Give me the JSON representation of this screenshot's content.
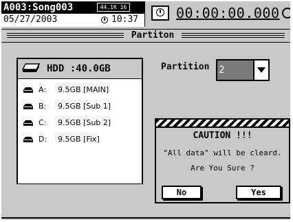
{
  "status": {
    "song": "A003:Song003",
    "fs_badge": "44.1K 16",
    "date": "05/27/2003",
    "time": "10:37",
    "counter": "00:00:00.000"
  },
  "title": "Partiton",
  "hdd": {
    "label": "HDD :40.0GB",
    "partitions": [
      {
        "letter": "A:",
        "size": "9.5GB [MAIN]"
      },
      {
        "letter": "B:",
        "size": "9.5GB [Sub 1]"
      },
      {
        "letter": "C:",
        "size": "9.5GB [Sub 2]"
      },
      {
        "letter": "D:",
        "size": "9.5GB [Fix]"
      }
    ]
  },
  "selector": {
    "label": "Partition",
    "value": "2"
  },
  "caution": {
    "title": "CAUTION !!!",
    "message1": "\"All data\" will be cleard.",
    "message2": "Are You Sure ?",
    "no_label": "No",
    "yes_label": "Yes"
  },
  "icons": {
    "hdd": "hdd-icon",
    "disk": "disk-icon",
    "clock": "clock-icon",
    "dropdown": "chevron-down-icon"
  }
}
